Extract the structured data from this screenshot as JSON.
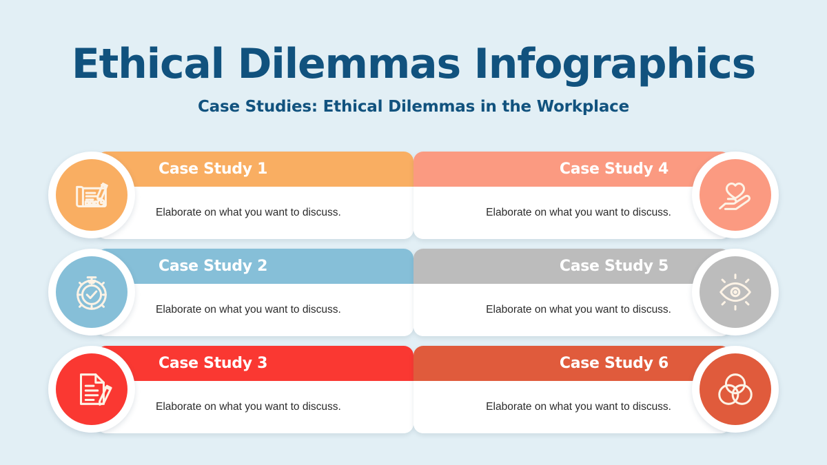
{
  "header": {
    "title": "Ethical Dilemmas Infographics",
    "subtitle": "Case Studies: Ethical Dilemmas in the Workplace",
    "title_color": "#11527e"
  },
  "background_color": "#e2eff5",
  "cards": [
    {
      "title": "Case Study 1",
      "description": "Elaborate on what you want to discuss.",
      "color": "#f9ae62",
      "icon": "contract-signing-icon",
      "side": "left",
      "row": 1
    },
    {
      "title": "Case Study 2",
      "description": "Elaborate on what you want to discuss.",
      "color": "#86bfd8",
      "icon": "stopwatch-check-icon",
      "side": "left",
      "row": 2
    },
    {
      "title": "Case Study 3",
      "description": "Elaborate on what you want to discuss.",
      "color": "#fa3832",
      "icon": "document-pencil-icon",
      "side": "left",
      "row": 3
    },
    {
      "title": "Case Study 4",
      "description": "Elaborate on what you want to discuss.",
      "color": "#fb9a81",
      "icon": "hand-heart-icon",
      "side": "right",
      "row": 1
    },
    {
      "title": "Case Study 5",
      "description": "Elaborate on what you want to discuss.",
      "color": "#bcbcbc",
      "icon": "eye-rays-icon",
      "side": "right",
      "row": 2
    },
    {
      "title": "Case Study 6",
      "description": "Elaborate on what you want to discuss.",
      "color": "#e05b3c",
      "icon": "venn-diagram-icon",
      "side": "right",
      "row": 3
    }
  ]
}
